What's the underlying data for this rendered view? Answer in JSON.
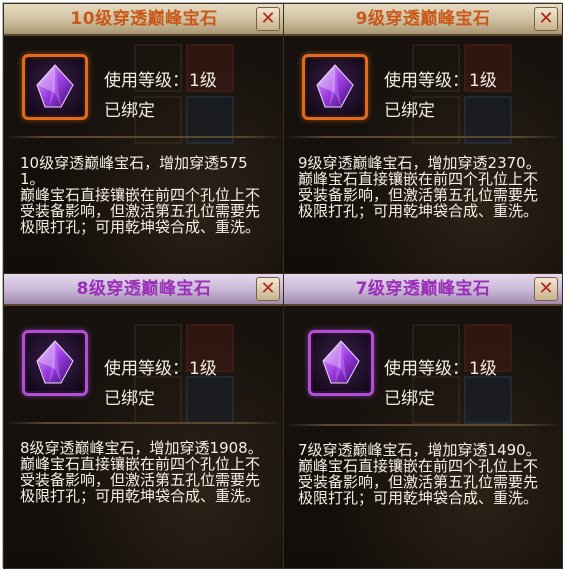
{
  "panels": [
    {
      "title": "10级穿透巅峰宝石",
      "level_text": "使用等级：1级",
      "bound_text": "已绑定",
      "desc_line1": "10级穿透巅峰宝石，增加穿透5751。",
      "desc_line2": "巅峰宝石直接镶嵌在前四个孔位上不受装备影响，但激活第五孔位需要先极限打孔；可用乾坤袋合成、重洗。",
      "close_label": "✕",
      "frame_color": "#e36a1c",
      "title_color": "#c8591a",
      "icon": "purple-gem-icon"
    },
    {
      "title": "9级穿透巅峰宝石",
      "level_text": "使用等级：1级",
      "bound_text": "已绑定",
      "desc_line1": "9级穿透巅峰宝石，增加穿透2370。",
      "desc_line2": "巅峰宝石直接镶嵌在前四个孔位上不受装备影响，但激活第五孔位需要先极限打孔；可用乾坤袋合成、重洗。",
      "close_label": "✕",
      "frame_color": "#e36a1c",
      "title_color": "#c8591a",
      "icon": "purple-gem-icon"
    },
    {
      "title": "8级穿透巅峰宝石",
      "level_text": "使用等级：1级",
      "bound_text": "已绑定",
      "desc_line1": "8级穿透巅峰宝石，增加穿透1908。",
      "desc_line2": "巅峰宝石直接镶嵌在前四个孔位上不受装备影响，但激活第五孔位需要先极限打孔；可用乾坤袋合成、重洗。",
      "close_label": "✕",
      "frame_color": "#b34fd6",
      "title_color": "#9a2fb8",
      "icon": "purple-gem-icon"
    },
    {
      "title": "7级穿透巅峰宝石",
      "level_text": "使用等级：1级",
      "bound_text": "已绑定",
      "desc_line1": "7级穿透巅峰宝石，增加穿透1490。",
      "desc_line2": "巅峰宝石直接镶嵌在前四个孔位上不受装备影响，但激活第五孔位需要先极限打孔；可用乾坤袋合成、重洗。",
      "close_label": "✕",
      "frame_color": "#b34fd6",
      "title_color": "#9a2fb8",
      "icon": "purple-gem-icon"
    }
  ]
}
